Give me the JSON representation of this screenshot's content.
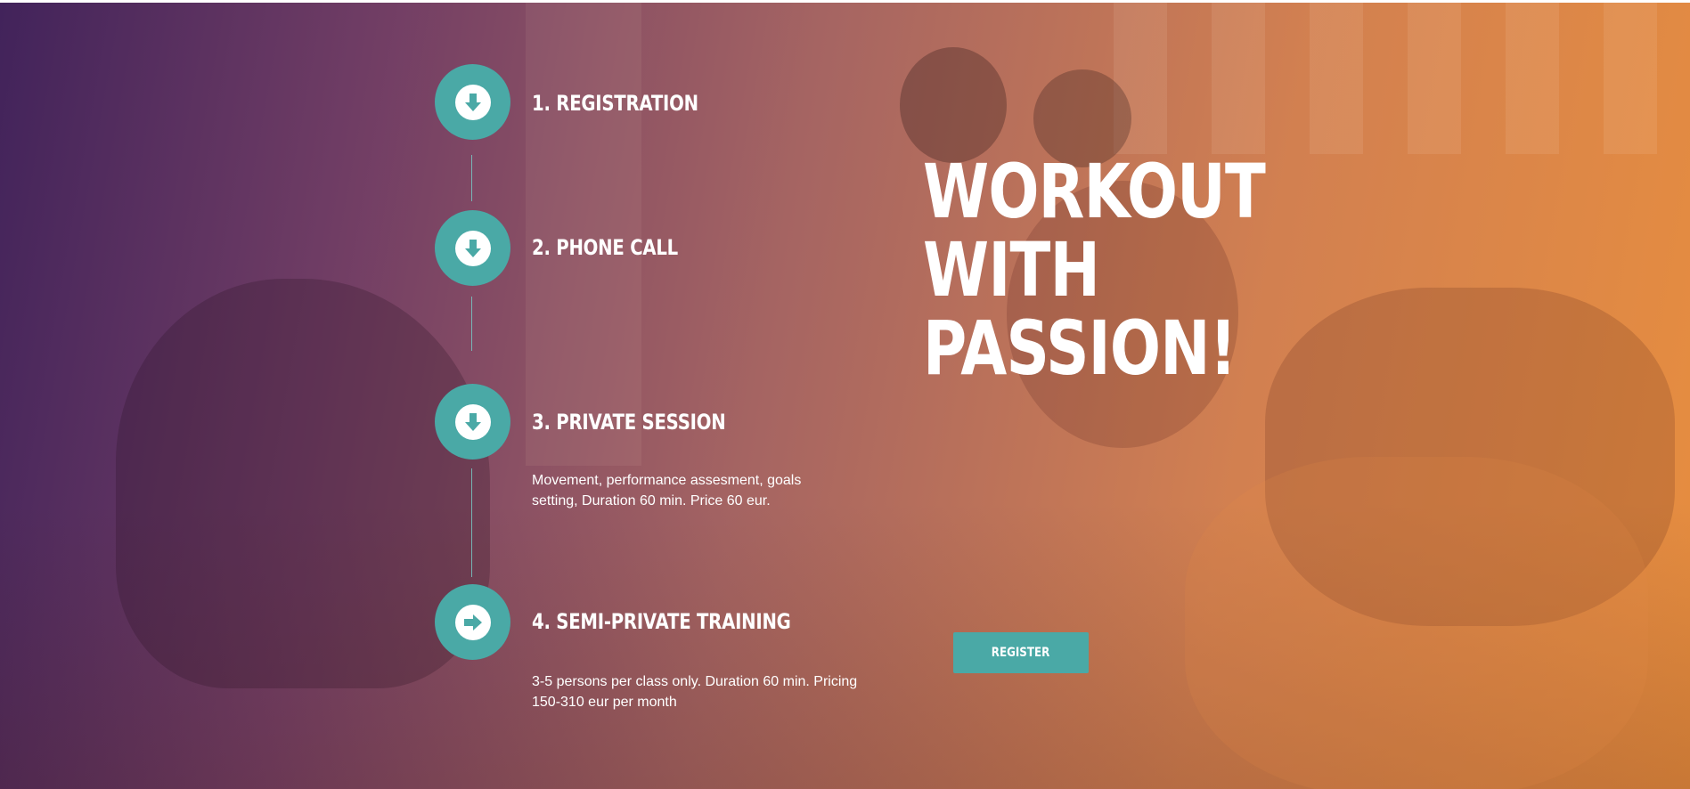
{
  "steps": [
    {
      "title": "1. REGISTRATION",
      "description": "",
      "icon": "arrow-down-circle-icon"
    },
    {
      "title": "2. PHONE CALL",
      "description": "",
      "icon": "arrow-down-circle-icon"
    },
    {
      "title": "3. PRIVATE SESSION",
      "description": "Movement, performance assesment, goals setting, Duration 60 min. Price 60 eur.",
      "icon": "arrow-down-circle-icon"
    },
    {
      "title": "4. SEMI-PRIVATE TRAINING",
      "description": "3-5 persons per class only. Duration 60 min. Pricing 150-310 eur per month",
      "icon": "arrow-right-circle-icon"
    }
  ],
  "headline": {
    "line1": "WORKOUT",
    "line2": "WITH",
    "line3": "PASSION!"
  },
  "cta": {
    "register_label": "REGISTER"
  },
  "colors": {
    "accent": "#4aa9a6",
    "gradient_start": "#3a1a54",
    "gradient_end": "#e47e24",
    "text": "#ffffff"
  }
}
